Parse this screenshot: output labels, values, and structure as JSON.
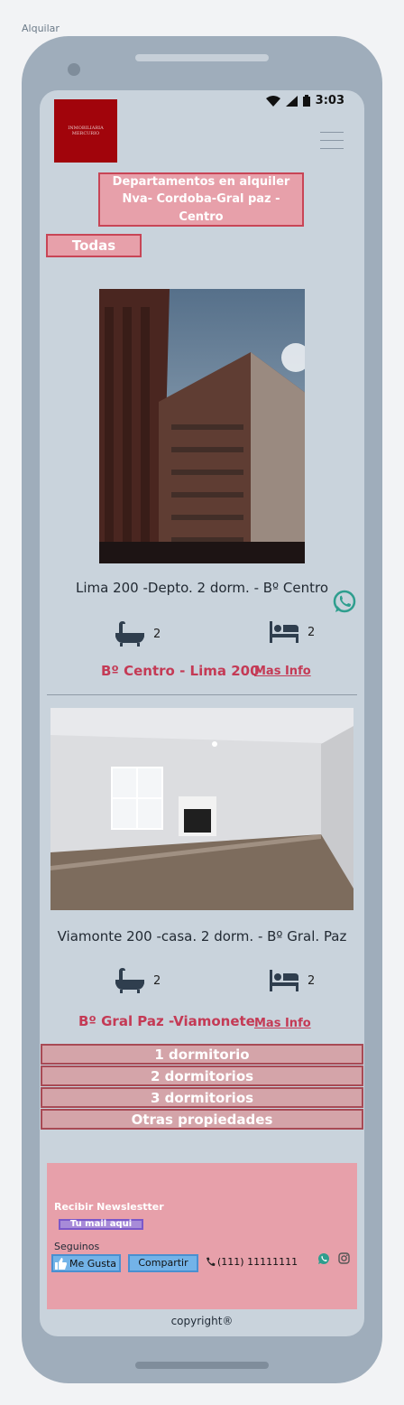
{
  "frame": {
    "label": "Alquilar"
  },
  "status_bar": {
    "time": "3:03"
  },
  "logo": {
    "line1": "INMOBILIARIA",
    "line2": "MERCURIO"
  },
  "hero": {
    "line1": "Departamentos en alquiler",
    "line2": "Nva- Cordoba-Gral paz - Centro"
  },
  "filter_all": {
    "label": "Todas"
  },
  "properties": [
    {
      "title": "Lima 200 -Depto. 2 dorm. - Bº Centro",
      "baths": "2",
      "beds": "2",
      "barrio": "Bº Centro - Lima 200",
      "link": "Mas Info"
    },
    {
      "title": "Viamonte 200 -casa. 2 dorm. - Bº Gral. Paz",
      "baths": "2",
      "beds": "2",
      "barrio": "Bº Gral Paz -Viamonete",
      "link": "Mas Info"
    }
  ],
  "filters": [
    "1 dormitorio",
    "2 dormitorios",
    "3 dormitorios",
    "Otras propiedades"
  ],
  "footer": {
    "newsletter_label": "Recibir Newslestter",
    "newsletter_placeholder": "Tu mail aqui",
    "follow_label": "Seguinos",
    "like_label": "Me Gusta",
    "share_label": "Compartir",
    "phone": "(111) 11111111"
  },
  "copyright": "copyright®",
  "colors": {
    "accent": "#c43a55",
    "box": "#e7a0aa",
    "screen": "#c9d3dc"
  },
  "icons": [
    "wifi-icon",
    "signal-icon",
    "battery-icon",
    "hamburger-icon",
    "bathtub-icon",
    "bed-icon",
    "whatsapp-icon",
    "thumbs-up-icon",
    "phone-icon",
    "instagram-icon"
  ]
}
